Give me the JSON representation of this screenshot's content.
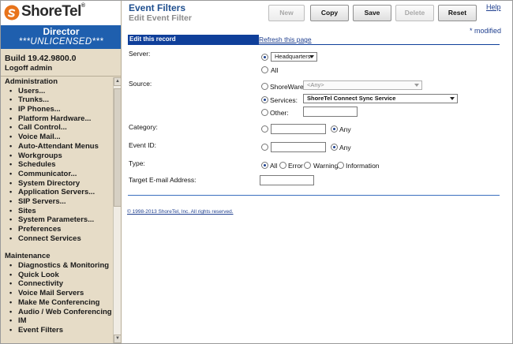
{
  "brand": {
    "name": "ShoreTel",
    "registered": "®",
    "colors": {
      "header_blue": "#1f5fae",
      "logo_orange": "#e8731a",
      "sidebar_bg": "#e6dcc7",
      "record_bar": "#0f3f9a",
      "link": "#1f3f8f"
    }
  },
  "sidebar": {
    "director_title": "Director",
    "license_status": "***UNLICENSED***",
    "build": "Build 19.42.9800.0",
    "logoff": "Logoff admin",
    "sections": [
      {
        "title": "Administration",
        "items": [
          "Users...",
          "Trunks...",
          "IP Phones...",
          "Platform Hardware...",
          "Call Control...",
          "Voice Mail...",
          "Auto-Attendant Menus",
          "Workgroups",
          "Schedules",
          "Communicator...",
          "System Directory",
          "Application Servers...",
          "SIP Servers...",
          "Sites",
          "System Parameters...",
          "Preferences",
          "Connect Services"
        ]
      },
      {
        "title": "Maintenance",
        "items": [
          "Diagnostics & Monitoring",
          "Quick Look",
          "Connectivity",
          "Voice Mail Servers",
          "Make Me Conferencing",
          "Audio / Web Conferencing",
          "IM",
          "Event Filters"
        ]
      }
    ]
  },
  "header": {
    "title": "Event Filters",
    "subtitle": "Edit Event Filter",
    "help": "Help",
    "modified": "* modified"
  },
  "toolbar": {
    "new_label": "New",
    "copy_label": "Copy",
    "save_label": "Save",
    "delete_label": "Delete",
    "reset_label": "Reset"
  },
  "record": {
    "bar_label": "Edit this record",
    "refresh_label": "Refresh this page"
  },
  "form": {
    "server": {
      "label": "Server:",
      "selected": "Headquarters",
      "all_label": "All",
      "mode": "selected"
    },
    "source": {
      "label": "Source:",
      "shoreware_label": "ShoreWare:",
      "shoreware_value": "<Any>",
      "services_label": "Services:",
      "services_value": "ShoreTel Connect Sync Service",
      "other_label": "Other:",
      "other_value": "",
      "mode": "services"
    },
    "category": {
      "label": "Category:",
      "value": "",
      "any_label": "Any",
      "mode": "any"
    },
    "event_id": {
      "label": "Event ID:",
      "value": "",
      "any_label": "Any",
      "mode": "any"
    },
    "type": {
      "label": "Type:",
      "options": [
        "All",
        "Error",
        "Warning",
        "Information"
      ],
      "selected": "All"
    },
    "target_email": {
      "label": "Target E-mail Address:",
      "value": ""
    }
  },
  "footer": {
    "copyright": "© 1998-2013 ShoreTel, Inc. All rights reserved."
  }
}
